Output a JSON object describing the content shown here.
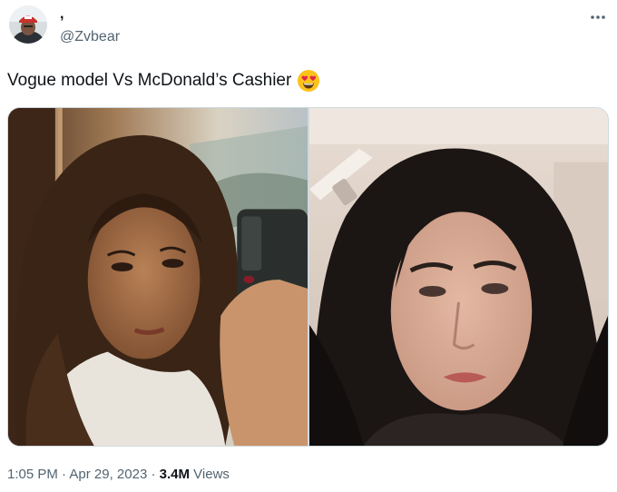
{
  "tweet": {
    "author": {
      "display_name": ",",
      "handle": "@Zvbear",
      "avatar_icon": "profile-avatar"
    },
    "text": "Vogue model Vs McDonald’s Cashier",
    "emoji": "smiling-face-with-heart-eyes",
    "more_icon": "ellipsis-icon",
    "media": {
      "left_photo_icon": "photo-selfie-woman",
      "right_photo_icon": "photo-woman-webcam"
    },
    "time": "1:05 PM",
    "separator": "·",
    "date": "Apr 29, 2023",
    "views_count": "3.4M",
    "views_label": "Views"
  },
  "colors": {
    "text_primary": "#0f1419",
    "text_secondary": "#536471",
    "border": "#cfd9de"
  }
}
